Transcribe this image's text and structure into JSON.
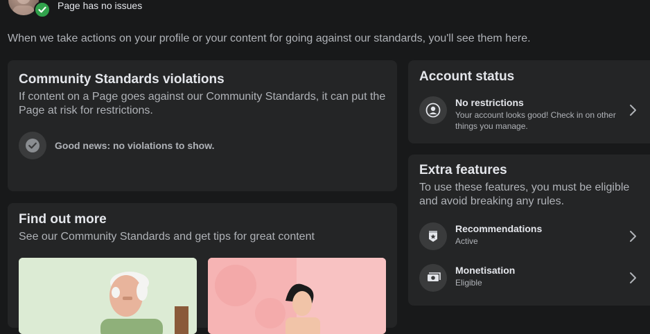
{
  "header": {
    "status": "Page has no issues",
    "intro": "When we take actions on your profile or your content for going against our standards, you'll see them here."
  },
  "violations": {
    "title": "Community Standards violations",
    "description": "If content on a Page goes against our Community Standards, it can put the Page at risk for restrictions.",
    "good_news": "Good news: no violations to show."
  },
  "find_out_more": {
    "title": "Find out more",
    "description": "See our Community Standards and get tips for great content"
  },
  "account_status": {
    "title": "Account status",
    "item_title": "No restrictions",
    "item_subtitle": "Your account looks good! Check in on other things you manage."
  },
  "extra_features": {
    "title": "Extra features",
    "description": "To use these features, you must be eligible and avoid breaking any rules.",
    "items": [
      {
        "title": "Recommendations",
        "subtitle": "Active"
      },
      {
        "title": "Monetisation",
        "subtitle": "Eligible"
      }
    ]
  },
  "colors": {
    "background": "#18191a",
    "card": "#242526",
    "success": "#31a24c",
    "secondary_text": "#b0b3b8"
  }
}
